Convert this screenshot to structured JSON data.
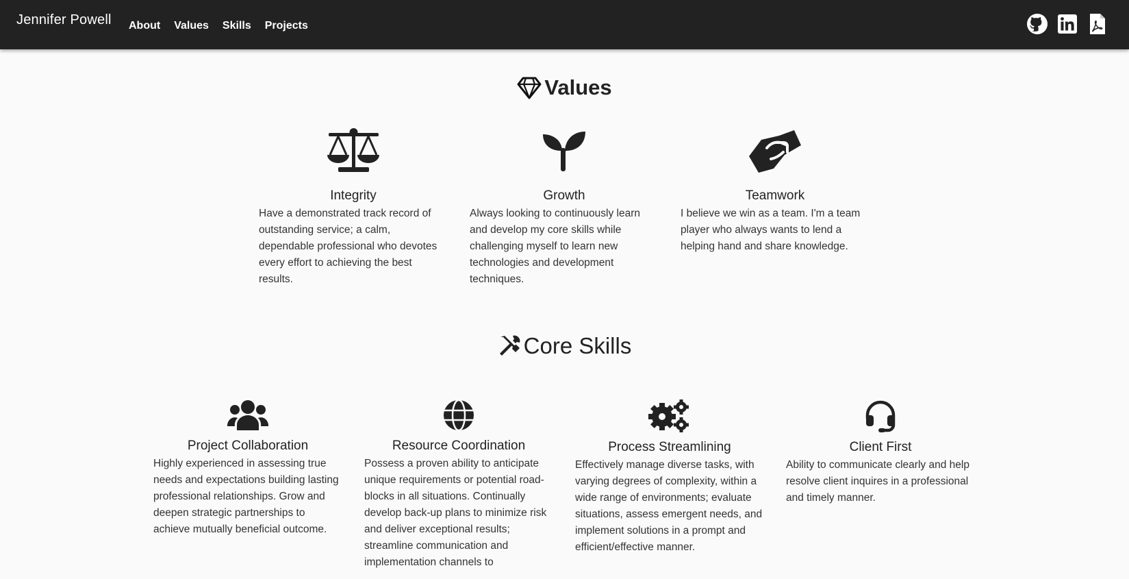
{
  "navbar": {
    "brand": "Jennifer Powell",
    "links": [
      "About",
      "Values",
      "Skills",
      "Projects"
    ],
    "icons": [
      "github-icon",
      "linkedin-icon",
      "pdf-resume-icon"
    ]
  },
  "values": {
    "title": "Values",
    "title_icon": "gem-icon",
    "items": [
      {
        "icon": "balance-scale-icon",
        "title": "Integrity",
        "text": "Have a demonstrated track record of outstanding service; a calm, dependable professional who devotes every effort to achieving the best results."
      },
      {
        "icon": "seedling-icon",
        "title": "Growth",
        "text": "Always looking to continuously learn and develop my core skills while challenging myself to learn new technologies and development techniques."
      },
      {
        "icon": "handshake-icon",
        "title": "Teamwork",
        "text": "I believe we win as a team. I'm a team player who always wants to lend a helping hand and share knowledge."
      }
    ]
  },
  "skills": {
    "title": "Core Skills",
    "title_icon": "tools-icon",
    "items": [
      {
        "icon": "users-icon",
        "title": "Project Collaboration",
        "text": "Highly experienced in assessing true needs and expectations building lasting professional relationships. Grow and deepen strategic partnerships to achieve mutually beneficial outcome."
      },
      {
        "icon": "globe-icon",
        "title": "Resource Coordination",
        "text": "Possess a proven ability to anticipate unique requirements or potential road-blocks in all situations. Continually develop back-up plans to minimize risk and deliver exceptional results; streamline communication and implementation channels to"
      },
      {
        "icon": "cogs-icon",
        "title": "Process Streamlining",
        "text": "Effectively manage diverse tasks, with varying degrees of complexity, within a wide range of environments; evaluate situations, assess emergent needs, and implement solutions in a prompt and efficient/effective manner."
      },
      {
        "icon": "headset-icon",
        "title": "Client First",
        "text": "Ability to communicate clearly and help resolve client inquires in a professional and timely manner."
      }
    ]
  }
}
